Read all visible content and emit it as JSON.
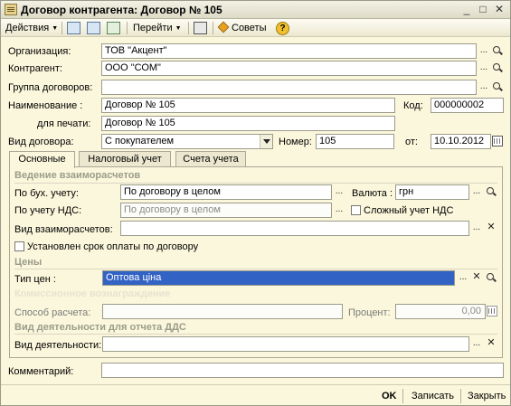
{
  "window": {
    "title": "Договор контрагента: Договор № 105",
    "minimize": "_",
    "maximize": "□",
    "close": "✕"
  },
  "toolbar": {
    "actions": "Действия",
    "goto": "Перейти",
    "tips": "Советы",
    "help": "?"
  },
  "fields": {
    "organization": {
      "label": "Организация:",
      "value": "ТОВ \"Акцент\""
    },
    "counterparty": {
      "label": "Контрагент:",
      "value": "ООО \"СОМ\""
    },
    "contract_group": {
      "label": "Группа договоров:",
      "value": ""
    },
    "name": {
      "label": "Наименование :",
      "value": "Договор № 105"
    },
    "code": {
      "label": "Код:",
      "value": "000000002"
    },
    "print_name": {
      "label": "для печати:",
      "value": "Договор № 105"
    },
    "contract_type": {
      "label": "Вид договора:",
      "value": "С покупателем"
    },
    "number": {
      "label": "Номер:",
      "value": "105"
    },
    "date": {
      "label": "от:",
      "value": "10.10.2012"
    }
  },
  "tabs": [
    "Основные",
    "Налоговый учет",
    "Счета учета"
  ],
  "main": {
    "section_settlements": "Ведение взаиморасчетов",
    "acc_label": "По бух. учету:",
    "acc_value": "По договору в целом",
    "currency_label": "Валюта :",
    "currency_value": "грн",
    "vat_label": "По учету НДС:",
    "vat_value": "По договору в целом",
    "complex_vat_label": "Сложный  учет НДС",
    "settlement_type_label": "Вид взаиморасчетов:",
    "settlement_type_value": "",
    "payment_term_label": "Установлен срок оплаты по договору",
    "section_prices": "Цены",
    "price_type_label": "Тип цен :",
    "price_type_value": "Оптова ціна",
    "section_commission": "Комиссионное вознаграждение",
    "calc_method_label": "Способ расчета:",
    "calc_method_value": "",
    "percent_label": "Процент:",
    "percent_value": "0,00",
    "section_activity": "Вид деятельности для отчета ДДС",
    "activity_label": "Вид деятельности:",
    "activity_value": ""
  },
  "comment": {
    "label": "Комментарий:",
    "value": ""
  },
  "footer": {
    "ok": "OK",
    "save": "Записать",
    "close": "Закрыть"
  },
  "colors": {
    "background": "#fbf7dc",
    "selection": "#3262c4",
    "section_header": "#9a9c8a"
  }
}
